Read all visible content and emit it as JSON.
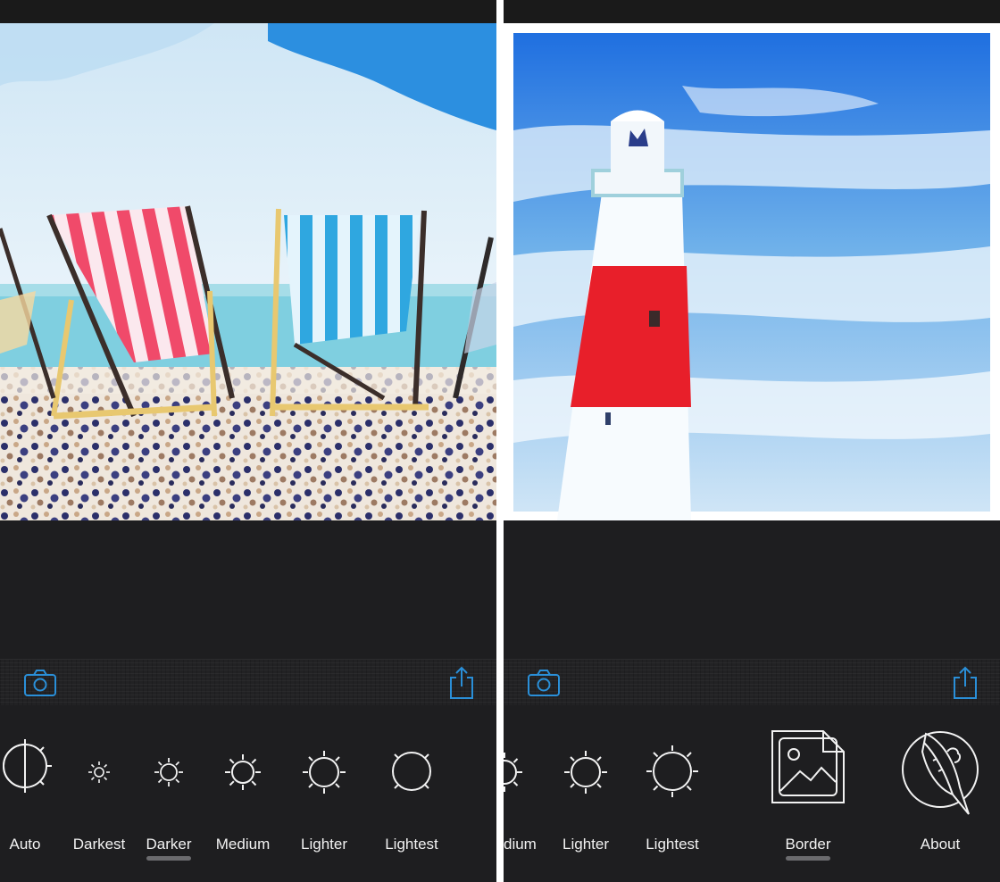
{
  "left_screen": {
    "options": [
      {
        "label": "Auto",
        "icon": "auto-contrast-icon",
        "selected": false
      },
      {
        "label": "Darkest",
        "icon": "sun-darkest-icon",
        "selected": false
      },
      {
        "label": "Darker",
        "icon": "sun-darker-icon",
        "selected": true
      },
      {
        "label": "Medium",
        "icon": "sun-medium-icon",
        "selected": false
      },
      {
        "label": "Lighter",
        "icon": "sun-lighter-icon",
        "selected": false
      },
      {
        "label": "Lightest",
        "icon": "sun-lightest-icon",
        "selected": false
      }
    ]
  },
  "right_screen": {
    "options": [
      {
        "label": "dium",
        "icon": "sun-medium-icon",
        "selected": false
      },
      {
        "label": "Lighter",
        "icon": "sun-lighter-icon",
        "selected": false
      },
      {
        "label": "Lightest",
        "icon": "sun-lightest-icon",
        "selected": false
      },
      {
        "label": "Border",
        "icon": "border-image-icon",
        "selected": true
      },
      {
        "label": "About",
        "icon": "rocket-icon",
        "selected": false
      }
    ]
  },
  "colors": {
    "accent": "#2a8fd8",
    "background": "#1e1e20",
    "label": "#f2f2f2",
    "selection_bar": "#6b6b6e"
  }
}
